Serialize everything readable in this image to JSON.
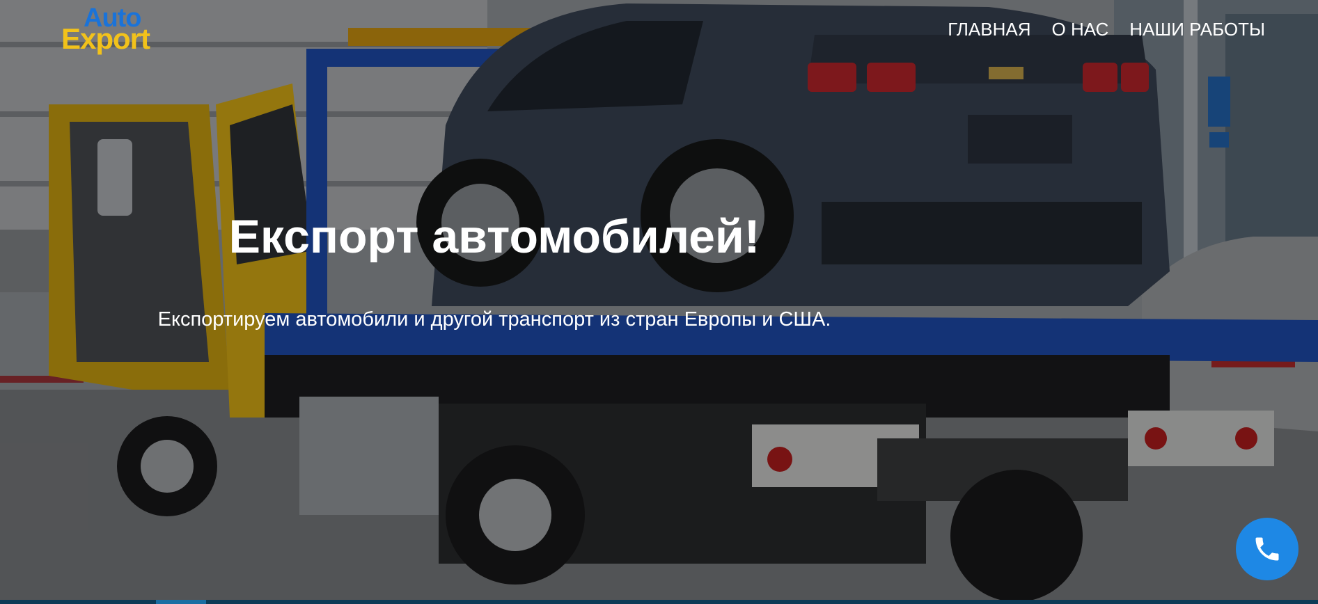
{
  "logo": {
    "line1": "Auto",
    "line2": "Export"
  },
  "nav": {
    "items": [
      {
        "label": "ГЛАВНАЯ"
      },
      {
        "label": "О НАС"
      },
      {
        "label": "НАШИ РАБОТЫ"
      }
    ]
  },
  "hero": {
    "title": "Експорт автомобилей!",
    "subtitle": "Експортируем автомобили и другой транспорт из стран Европы и США."
  },
  "call_button": {
    "icon": "phone-icon"
  },
  "colors": {
    "logo_blue": "#1a73d9",
    "logo_yellow": "#f2c21b",
    "call_button": "#1e88e5",
    "text": "#ffffff"
  }
}
